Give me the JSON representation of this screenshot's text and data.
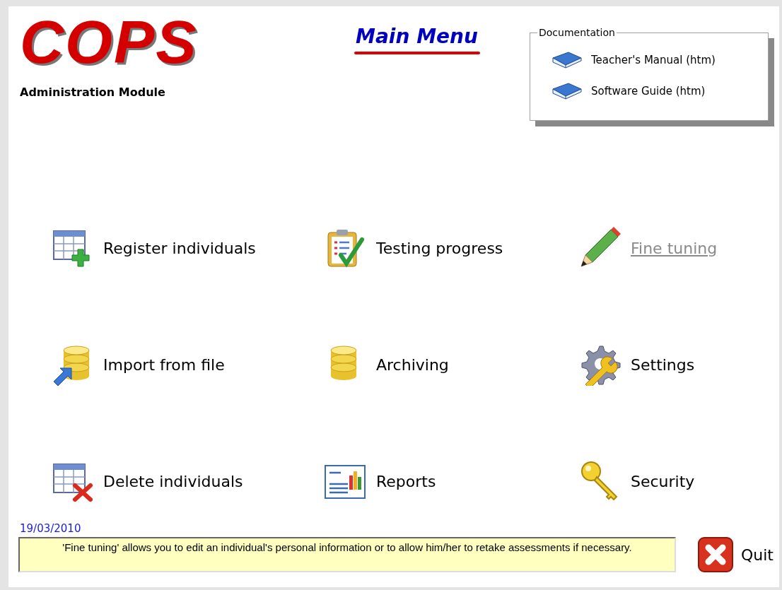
{
  "logo": {
    "text": "COPS",
    "subtitle": "Administration Module"
  },
  "title": "Main Menu",
  "documentation": {
    "legend": "Documentation",
    "links": [
      {
        "label": "Teacher's Manual (htm)"
      },
      {
        "label": "Software Guide (htm)"
      }
    ]
  },
  "menu": [
    {
      "label": "Register individuals",
      "kind": "table-add",
      "hovered": false
    },
    {
      "label": "Testing progress",
      "kind": "clipboard-check",
      "hovered": false
    },
    {
      "label": "Fine tuning",
      "kind": "pencil",
      "hovered": true
    },
    {
      "label": "Import from file",
      "kind": "database-import",
      "hovered": false
    },
    {
      "label": "Archiving",
      "kind": "database",
      "hovered": false
    },
    {
      "label": "Settings",
      "kind": "gear-wrench",
      "hovered": false
    },
    {
      "label": "Delete individuals",
      "kind": "table-delete",
      "hovered": false
    },
    {
      "label": "Reports",
      "kind": "report-chart",
      "hovered": false
    },
    {
      "label": "Security",
      "kind": "key",
      "hovered": false
    }
  ],
  "date": "19/03/2010",
  "status_message": "'Fine tuning' allows you to edit an individual's personal information or to allow him/her to retake assessments if necessary.",
  "quit_button": "Quit"
}
